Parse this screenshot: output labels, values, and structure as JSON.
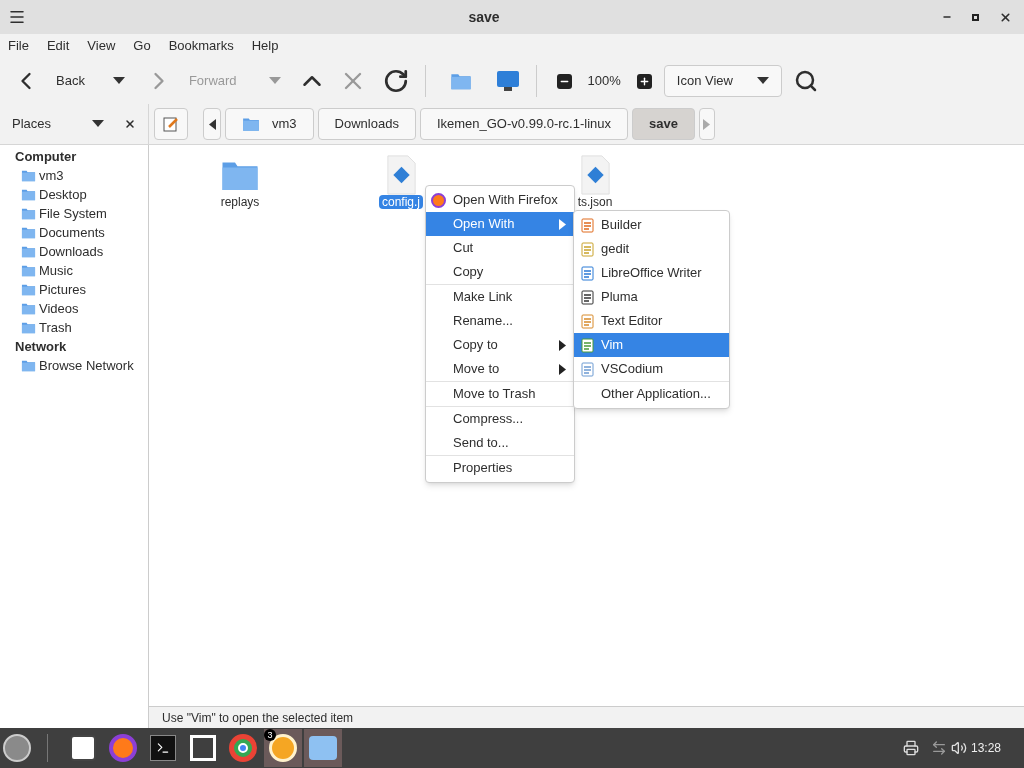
{
  "window": {
    "title": "save"
  },
  "menubar": [
    "File",
    "Edit",
    "View",
    "Go",
    "Bookmarks",
    "Help"
  ],
  "toolbar": {
    "back": {
      "label": "Back",
      "disabled": false
    },
    "forward": {
      "label": "Forward",
      "disabled": true
    },
    "zoom": "100%",
    "view_select": "Icon View"
  },
  "sidebar": {
    "title": "Places",
    "sections": [
      {
        "title": "Computer",
        "items": [
          "vm3",
          "Desktop",
          "File System",
          "Documents",
          "Downloads",
          "Music",
          "Pictures",
          "Videos",
          "Trash"
        ]
      },
      {
        "title": "Network",
        "items": [
          "Browse Network"
        ]
      }
    ]
  },
  "path": [
    {
      "label": "vm3",
      "selected": false
    },
    {
      "label": "Downloads",
      "selected": false
    },
    {
      "label": "Ikemen_GO-v0.99.0-rc.1-linux",
      "selected": false
    },
    {
      "label": "save",
      "selected": true
    }
  ],
  "files": [
    {
      "name": "replays",
      "kind": "folder",
      "selected": false
    },
    {
      "name": "config.j",
      "kind": "file",
      "selected": true
    },
    {
      "name": "ts.json",
      "kind": "file",
      "selected": false
    }
  ],
  "context_menu": {
    "groups": [
      [
        {
          "label": "Open With Firefox",
          "selected": false,
          "submenu": false
        },
        {
          "label": "Open With",
          "selected": true,
          "submenu": true
        },
        {
          "label": "Cut",
          "selected": false,
          "submenu": false
        },
        {
          "label": "Copy",
          "selected": false,
          "submenu": false
        }
      ],
      [
        {
          "label": "Make Link",
          "selected": false,
          "submenu": false
        },
        {
          "label": "Rename...",
          "selected": false,
          "submenu": false
        },
        {
          "label": "Copy to",
          "selected": false,
          "submenu": true
        },
        {
          "label": "Move to",
          "selected": false,
          "submenu": true
        }
      ],
      [
        {
          "label": "Move to Trash",
          "selected": false,
          "submenu": false
        }
      ],
      [
        {
          "label": "Compress...",
          "selected": false,
          "submenu": false
        },
        {
          "label": "Send to...",
          "selected": false,
          "submenu": false
        }
      ],
      [
        {
          "label": "Properties",
          "selected": false,
          "submenu": false
        }
      ]
    ]
  },
  "submenu": {
    "groups": [
      [
        {
          "label": "Builder",
          "selected": false
        },
        {
          "label": "gedit",
          "selected": false
        },
        {
          "label": "LibreOffice Writer",
          "selected": false
        },
        {
          "label": "Pluma",
          "selected": false
        },
        {
          "label": "Text Editor",
          "selected": false
        },
        {
          "label": "Vim",
          "selected": true
        },
        {
          "label": "VSCodium",
          "selected": false
        }
      ],
      [
        {
          "label": "Other Application...",
          "selected": false
        }
      ]
    ]
  },
  "status_bar": "Use \"Vim\" to open the selected item",
  "taskbar": {
    "apps": [
      {
        "active": false
      },
      {
        "active": false
      },
      {
        "active": false
      },
      {
        "active": false
      },
      {
        "active": false
      },
      {
        "active": true,
        "badge": "3"
      },
      {
        "active": true
      }
    ],
    "clock": "13:28"
  }
}
